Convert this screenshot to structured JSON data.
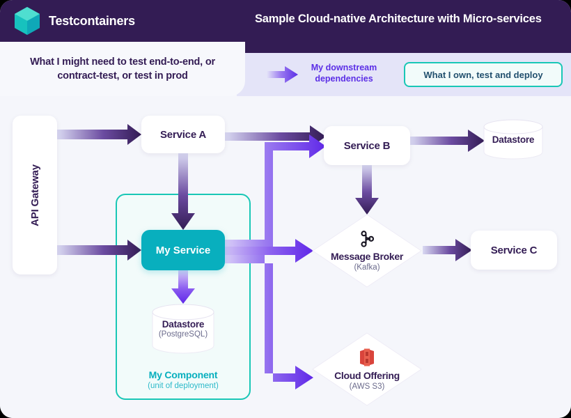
{
  "brand": {
    "name": "Testcontainers",
    "logo_icon": "cube-icon",
    "logo_color": "#19c7b6"
  },
  "header": {
    "title": "Sample Cloud-native Architecture with Micro-services",
    "background_color": "#331c54"
  },
  "callout": {
    "text": "What I might need to test end-to-end, or contract-test, or test in prod"
  },
  "legend": {
    "dependency_icon": "right-arrow-icon",
    "dependency_label": "My downstream dependencies",
    "ownership_label": "What I own, test and deploy",
    "dependency_color": "#5b2ee6",
    "ownership_color": "#19c7b6"
  },
  "diagram": {
    "nodes": {
      "api_gateway": {
        "label": "API Gateway",
        "shape": "box"
      },
      "service_a": {
        "label": "Service A",
        "shape": "box"
      },
      "service_b": {
        "label": "Service B",
        "shape": "box"
      },
      "service_c": {
        "label": "Service C",
        "shape": "box"
      },
      "my_service": {
        "label": "My Service",
        "shape": "box",
        "color": "#08afbe"
      },
      "datastore_b": {
        "label": "Datastore",
        "shape": "cylinder"
      },
      "datastore_mine": {
        "label": "Datastore",
        "sublabel": "(PostgreSQL)",
        "shape": "cylinder"
      },
      "message_broker": {
        "label": "Message Broker",
        "sublabel": "(Kafka)",
        "shape": "diamond",
        "icon": "kafka-icon"
      },
      "cloud_offering": {
        "label": "Cloud Offering",
        "sublabel": "(AWS S3)",
        "shape": "diamond",
        "icon": "aws-s3-icon"
      }
    },
    "component": {
      "title": "My Component",
      "subtitle": "(unit of deployment)"
    }
  }
}
